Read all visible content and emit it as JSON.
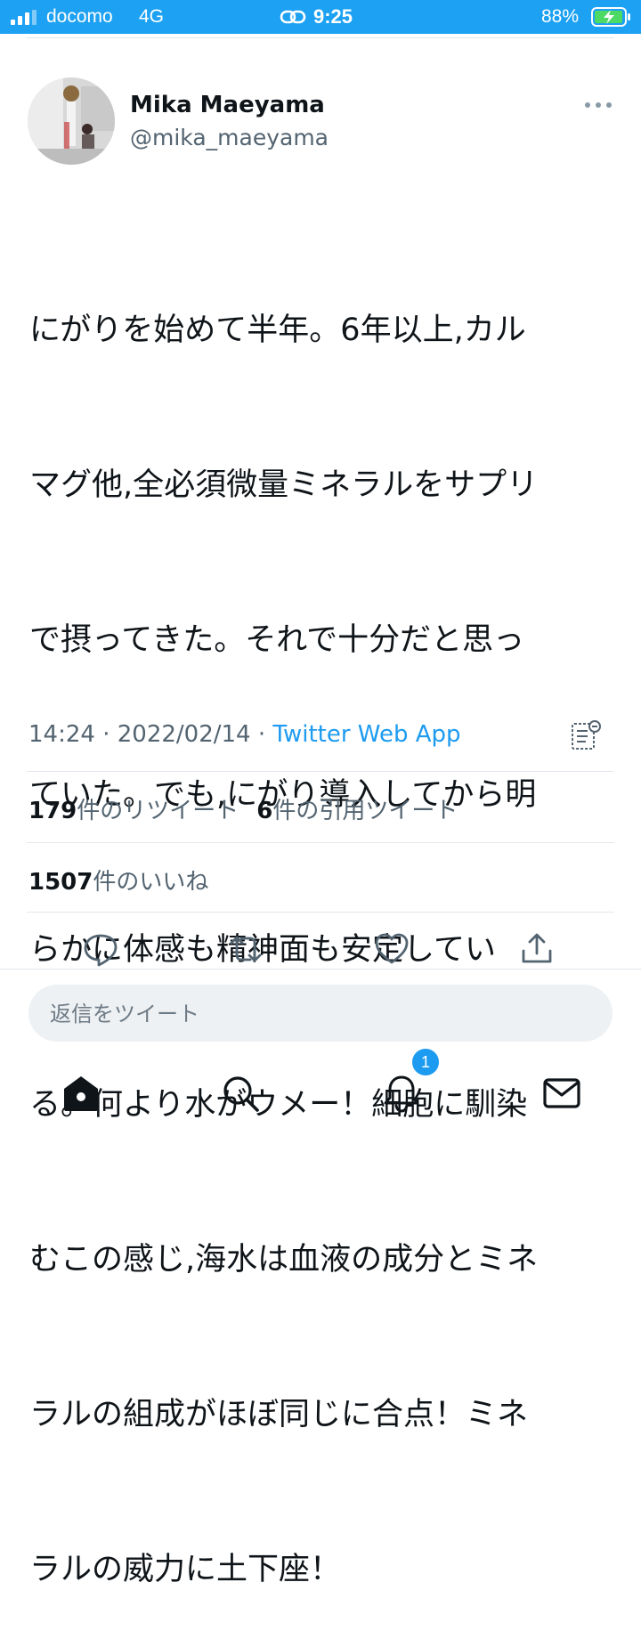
{
  "status_bar": {
    "carrier": "docomo",
    "network": "4G",
    "time": "9:25",
    "battery": "88%",
    "icons": [
      "signal-icon",
      "link-icon",
      "battery-charging-icon"
    ]
  },
  "tweet": {
    "author": {
      "name": "Mika Maeyama",
      "handle": "@mika_maeyama"
    },
    "text_lines": [
      "にがりを始めて半年。6年以上,カル",
      "マグ他,全必須微量ミネラルをサプリ",
      "で摂ってきた。それで十分だと思っ",
      "ていた。でも,にがり導入してから明",
      "らかに体感も精神面も安定してい",
      "る。何より水がウメー！細胞に馴染",
      "むこの感じ,海水は血液の成分とミネ",
      "ラルの組成がほぼ同じに合点！ミネ",
      "ラルの威力に土下座！"
    ],
    "time": "14:24",
    "date": "2022/02/14",
    "separator": "·",
    "source": "Twitter Web App",
    "retweets": {
      "count": "179",
      "label": "件のリツイート"
    },
    "quotes": {
      "count": "6",
      "label": "件の引用ツイート"
    },
    "likes": {
      "count": "1507",
      "label": "件のいいね"
    }
  },
  "actions": [
    "reply-icon",
    "retweet-icon",
    "like-icon",
    "share-icon"
  ],
  "reply_bar": {
    "placeholder": "返信をツイート"
  },
  "bottom_nav": {
    "items": [
      "home-icon",
      "search-icon",
      "notifications-icon",
      "messages-icon"
    ],
    "notification_badge": "1"
  },
  "colors": {
    "accent": "#1d9bf0",
    "status_bar": "#1da1f2",
    "text": "#0f1419",
    "secondary_text": "#536471"
  }
}
